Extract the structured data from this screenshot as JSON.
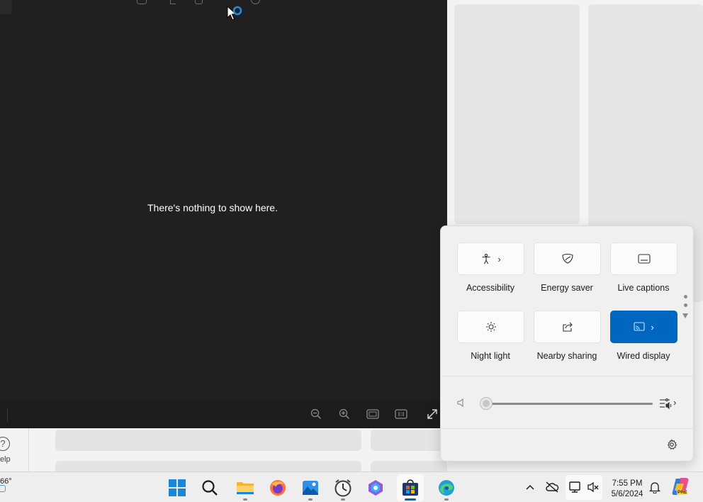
{
  "viewer": {
    "empty_message": "There's nothing to show here."
  },
  "help": {
    "icon_glyph": "?",
    "label": "elp"
  },
  "quick_settings": {
    "tiles": [
      {
        "label": "Accessibility",
        "icon": "accessibility-icon",
        "has_chevron": true,
        "active": false
      },
      {
        "label": "Energy saver",
        "icon": "energy-saver-icon",
        "has_chevron": false,
        "active": false
      },
      {
        "label": "Live captions",
        "icon": "live-captions-icon",
        "has_chevron": false,
        "active": false
      },
      {
        "label": "Night light",
        "icon": "night-light-icon",
        "has_chevron": false,
        "active": false
      },
      {
        "label": "Nearby sharing",
        "icon": "nearby-sharing-icon",
        "has_chevron": false,
        "active": false
      },
      {
        "label": "Wired display",
        "icon": "wired-display-icon",
        "has_chevron": true,
        "active": true
      }
    ],
    "chevron": "›",
    "volume_level": 0,
    "accent_color": "#0067c0"
  },
  "taskbar": {
    "weather_temp": "66°",
    "apps": [
      "start-icon",
      "search-icon",
      "file-explorer-icon",
      "firefox-icon",
      "photos-icon",
      "clock-app-icon",
      "copilot-app-icon",
      "microsoft-store-icon",
      "edge-icon"
    ],
    "active_app": "microsoft-store-icon",
    "clock": {
      "time": "7:55 PM",
      "date": "5/6/2024"
    },
    "copilot_badge": "PRE"
  }
}
